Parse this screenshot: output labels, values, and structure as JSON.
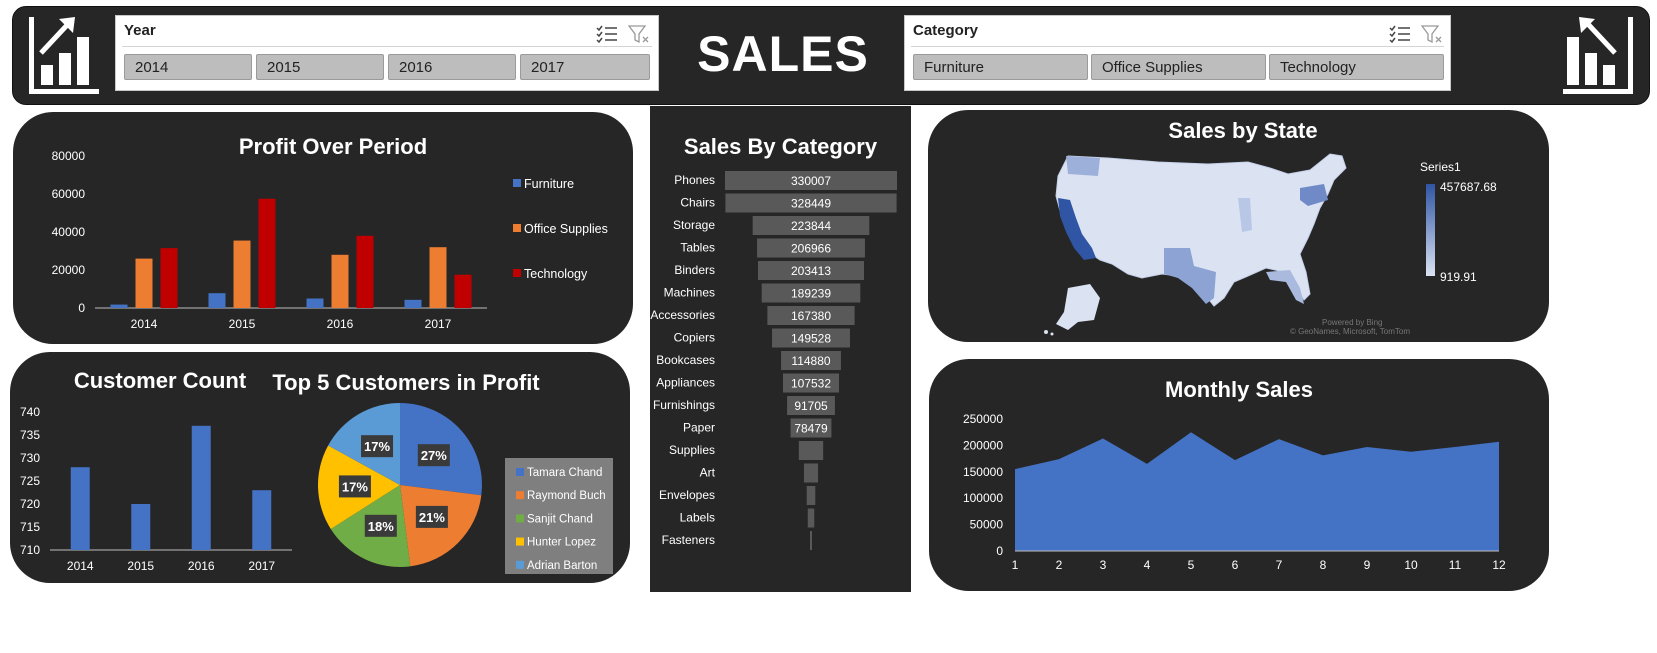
{
  "header": {
    "title": "SALES",
    "year_slicer": {
      "title": "Year",
      "options": [
        "2014",
        "2015",
        "2016",
        "2017"
      ]
    },
    "category_slicer": {
      "title": "Category",
      "options": [
        "Furniture",
        "Office Supplies",
        "Technology"
      ]
    }
  },
  "profit_over_period": {
    "title": "Profit Over Period",
    "chart_data": {
      "type": "bar",
      "categories": [
        "2014",
        "2015",
        "2016",
        "2017"
      ],
      "series": [
        {
          "name": "Furniture",
          "color": "#4472c4",
          "values": [
            1800,
            7800,
            5000,
            4300
          ]
        },
        {
          "name": "Office Supplies",
          "color": "#ed7d31",
          "values": [
            26000,
            35500,
            28000,
            32000
          ]
        },
        {
          "name": "Technology",
          "color": "#c00000",
          "values": [
            31500,
            57500,
            38000,
            17500
          ]
        }
      ],
      "y_ticks": [
        "0",
        "20000",
        "40000",
        "60000",
        "80000"
      ],
      "ylim": [
        0,
        80000
      ]
    }
  },
  "customer_count": {
    "title": "Customer Count",
    "chart_data": {
      "type": "bar",
      "categories": [
        "2014",
        "2015",
        "2016",
        "2017"
      ],
      "values": [
        728,
        720,
        737,
        723
      ],
      "y_ticks": [
        "710",
        "715",
        "720",
        "725",
        "730",
        "735",
        "740"
      ],
      "ylim": [
        710,
        740
      ],
      "color": "#4472c4"
    }
  },
  "top5_customers": {
    "title": "Top 5 Customers in Profit",
    "chart_data": {
      "type": "pie",
      "labels": [
        "Tamara Chand",
        "Raymond Buch",
        "Sanjit Chand",
        "Hunter Lopez",
        "Adrian Barton"
      ],
      "values": [
        27,
        21,
        18,
        17,
        17
      ],
      "data_labels": [
        "27%",
        "21%",
        "18%",
        "17%",
        "17%"
      ],
      "colors": [
        "#4472c4",
        "#ed7d31",
        "#70ad47",
        "#ffc000",
        "#5b9bd5"
      ]
    }
  },
  "sales_by_category": {
    "title": "Sales By Category",
    "chart_data": {
      "type": "bar",
      "orientation": "funnel",
      "categories": [
        "Phones",
        "Chairs",
        "Storage",
        "Tables",
        "Binders",
        "Machines",
        "Accessories",
        "Copiers",
        "Bookcases",
        "Appliances",
        "Furnishings",
        "Paper",
        "Supplies",
        "Art",
        "Envelopes",
        "Labels",
        "Fasteners"
      ],
      "values": [
        330007,
        328449,
        223844,
        206966,
        203413,
        189239,
        167380,
        149528,
        114880,
        107532,
        91705,
        78479,
        46674,
        27119,
        16476,
        12486,
        3024
      ],
      "data_labels": [
        "330007",
        "328449",
        "223844",
        "206966",
        "203413",
        "189239",
        "167380",
        "149528",
        "114880",
        "107532",
        "91705",
        "78479",
        "",
        "",
        "",
        "",
        ""
      ],
      "color": "#595959"
    }
  },
  "sales_by_state": {
    "title": "Sales by State",
    "legend_title": "Series1",
    "max_label": "457687.68",
    "min_label": "919.91",
    "attribution_1": "Powered by Bing",
    "attribution_2": "© GeoNames, Microsoft, TomTom",
    "color_low": "#dbe3f3",
    "color_high": "#2f55a4"
  },
  "monthly_sales": {
    "title": "Monthly Sales",
    "chart_data": {
      "type": "area",
      "x": [
        1,
        2,
        3,
        4,
        5,
        6,
        7,
        8,
        9,
        10,
        11,
        12
      ],
      "values": [
        155000,
        174000,
        213000,
        165000,
        225000,
        172000,
        212000,
        181000,
        197000,
        188000,
        197000,
        207000
      ],
      "y_ticks": [
        "0",
        "50000",
        "100000",
        "150000",
        "200000",
        "250000"
      ],
      "ylim": [
        0,
        250000
      ],
      "color": "#4472c4"
    }
  }
}
